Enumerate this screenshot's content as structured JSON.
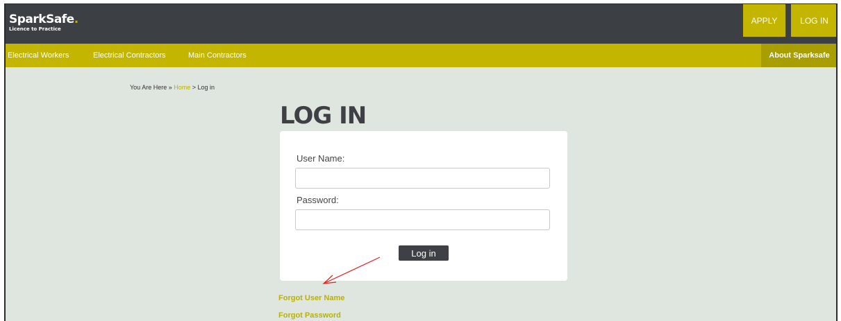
{
  "brand": {
    "name": "SparkSafe",
    "dot": ".",
    "tagline": "Licence to Practice"
  },
  "header": {
    "apply_label": "APPLY",
    "login_label": "LOG IN"
  },
  "nav": {
    "items": [
      "Electrical Workers",
      "Electrical Contractors",
      "Main Contractors"
    ],
    "about_label": "About Sparksafe"
  },
  "breadcrumb": {
    "prefix": "You Are Here » ",
    "home": "Home",
    "current": " > Log in"
  },
  "page": {
    "title": "LOG IN"
  },
  "form": {
    "username_label": "User Name:",
    "username_value": "",
    "password_label": "Password:",
    "password_value": "",
    "submit_label": "Log in"
  },
  "links": {
    "forgot_username": "Forgot User Name",
    "forgot_password": "Forgot Password"
  },
  "colors": {
    "accent": "#c4b600",
    "header_bg": "#3c4044",
    "page_bg": "#dfe5df",
    "annotation": "#e02020"
  }
}
